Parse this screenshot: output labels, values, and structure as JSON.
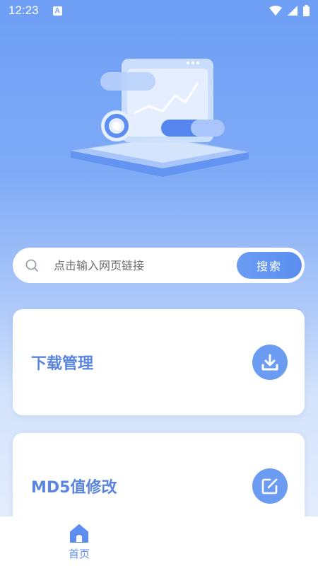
{
  "status_bar": {
    "time": "12:23",
    "notification_icon": "a-letter-icon",
    "icons": [
      "wifi-icon",
      "signal-icon",
      "battery-icon"
    ]
  },
  "search": {
    "placeholder": "点击输入网页链接",
    "button_label": "搜索"
  },
  "cards": [
    {
      "title": "下载管理",
      "icon": "download-icon"
    },
    {
      "title": "MD5值修改",
      "icon": "edit-icon"
    }
  ],
  "bottom_nav": {
    "items": [
      {
        "label": "首页",
        "icon": "home-icon",
        "active": true
      }
    ]
  },
  "colors": {
    "accent": "#5b8ef0",
    "card_title": "#5a86df",
    "background_top": "#6e9ff5"
  }
}
